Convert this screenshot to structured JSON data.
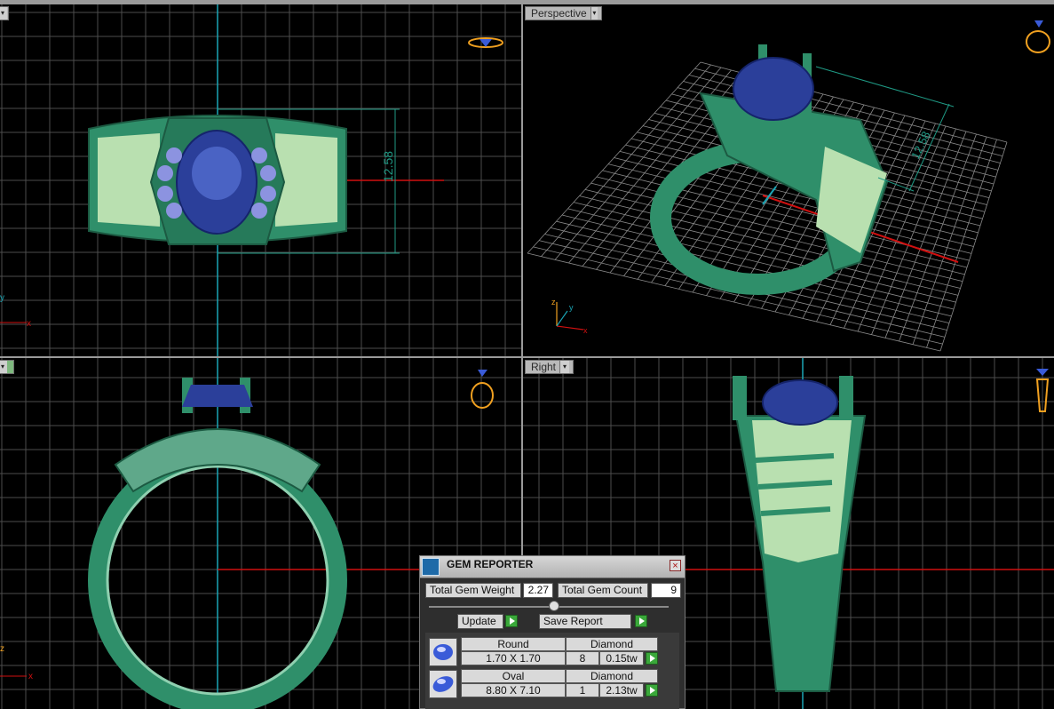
{
  "viewports": {
    "top_left": {
      "label": ""
    },
    "top_right": {
      "label": "Perspective"
    },
    "bottom_left": {
      "label": ""
    },
    "bottom_right": {
      "label": "Right"
    }
  },
  "dimensions": {
    "front": "12.58",
    "perspective": "12.58"
  },
  "axes": {
    "x": "x",
    "y": "y",
    "z": "z"
  },
  "colors": {
    "metal": "#2f8f6a",
    "metal_light": "#b9e0b0",
    "sapphire": "#2b3f9a",
    "diamond": "#8c93e0",
    "grid": "#5a5a5a",
    "axis_x": "#d01010",
    "axis_y": "#1aa5b5",
    "dim": "#1f9a85",
    "gizmo": "#f0a020"
  },
  "gem_reporter": {
    "title": "GEM REPORTER",
    "total_weight_label": "Total Gem Weight",
    "total_weight": "2.27",
    "total_count_label": "Total Gem Count",
    "total_count": "9",
    "update_label": "Update",
    "save_label": "Save Report",
    "gems": [
      {
        "shape": "Round",
        "material": "Diamond",
        "size": "1.70 X 1.70",
        "count": "8",
        "weight": "0.15tw"
      },
      {
        "shape": "Oval",
        "material": "Diamond",
        "size": "8.80 X 7.10",
        "count": "1",
        "weight": "2.13tw"
      }
    ]
  }
}
